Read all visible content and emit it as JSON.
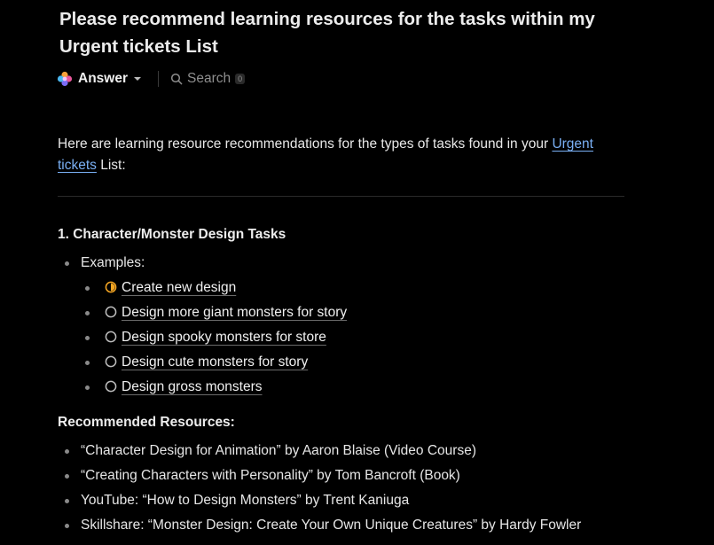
{
  "header": {
    "title": "Please recommend learning resources for the tasks within my Urgent tickets List"
  },
  "toolbar": {
    "answer_label": "Answer",
    "search_label": "Search",
    "search_count": "0"
  },
  "intro": {
    "before": "Here are learning resource recommendations for the types of tasks found in your ",
    "link": "Urgent tickets",
    "after": " List:"
  },
  "section1": {
    "heading": "1. Character/Monster Design Tasks",
    "examples_label": "Examples:",
    "tasks": [
      {
        "label": "Create new design",
        "status": "in-progress"
      },
      {
        "label": "Design more giant monsters for story",
        "status": "todo"
      },
      {
        "label": "Design spooky monsters for store",
        "status": "todo"
      },
      {
        "label": "Design cute monsters for story",
        "status": "todo"
      },
      {
        "label": "Design gross monsters",
        "status": "todo"
      }
    ],
    "resources_heading": "Recommended Resources:",
    "resources": [
      "“Character Design for Animation” by Aaron Blaise (Video Course)",
      "“Creating Characters with Personality” by Tom Bancroft (Book)",
      "YouTube: “How to Design Monsters” by Trent Kaniuga",
      "Skillshare: “Monster Design: Create Your Own Unique Creatures” by Hardy Fowler"
    ]
  },
  "colors": {
    "background": "#000000",
    "link": "#7ab0f5",
    "in_progress": "#f5a623",
    "todo": "#bdbdbd"
  },
  "icons": {
    "logo": "app-logo-icon",
    "caret": "chevron-down-icon",
    "search": "search-icon",
    "in_progress": "half-circle-status-icon",
    "todo": "empty-circle-status-icon"
  }
}
